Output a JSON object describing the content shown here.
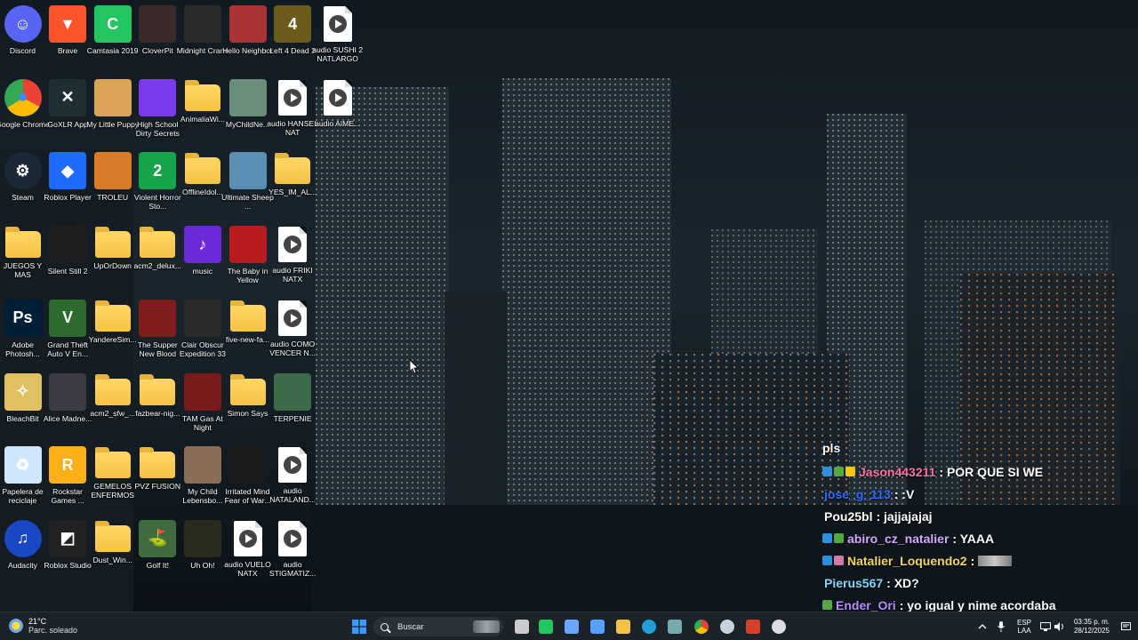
{
  "desktop": {
    "icons": [
      {
        "label": "Discord",
        "icon": "discord-icon",
        "color": "#5865f2"
      },
      {
        "label": "Brave",
        "icon": "brave-icon",
        "color": "#fb542b"
      },
      {
        "label": "Camtasia 2019",
        "icon": "camtasia-icon",
        "color": "#22c55e"
      },
      {
        "label": "CloverPit",
        "icon": "cloverpit-icon",
        "color": "#3a2a2a"
      },
      {
        "label": "Midnight Crane",
        "icon": "midnight-crane-icon",
        "color": "#2b2b2b"
      },
      {
        "label": "Hello Neighbor",
        "icon": "hello-neighbor-icon",
        "color": "#a33"
      },
      {
        "label": "Left 4 Dead 2",
        "icon": "left4dead2-icon",
        "color": "#6b5a1c"
      },
      {
        "label": "audio SUSHI 2 NATLARGO",
        "icon": "audio-file-icon",
        "color": "#ffffff"
      },
      {
        "label": "Google Chrome",
        "icon": "chrome-icon",
        "color": "#4285f4"
      },
      {
        "label": "GoXLR App",
        "icon": "goxlr-icon",
        "color": "#1f2f33"
      },
      {
        "label": "My Little Puppy",
        "icon": "my-little-puppy-icon",
        "color": "#d9a35a"
      },
      {
        "label": "High School Dirty Secrets",
        "icon": "high-school-icon",
        "color": "#7c3aed"
      },
      {
        "label": "AnimaliaWi...",
        "icon": "folder-icon",
        "color": "#f6c244"
      },
      {
        "label": "MyChildNe...",
        "icon": "my-child-icon",
        "color": "#6b8e7a"
      },
      {
        "label": "audio HANSEL NAT",
        "icon": "audio-file-icon",
        "color": "#ffffff"
      },
      {
        "label": "audio AIME...",
        "icon": "audio-file-icon",
        "color": "#ffffff"
      },
      {
        "label": "Steam",
        "icon": "steam-icon",
        "color": "#1b2838"
      },
      {
        "label": "Roblox Player",
        "icon": "roblox-icon",
        "color": "#1e6bff"
      },
      {
        "label": "TROLEU",
        "icon": "troleu-icon",
        "color": "#d97b29"
      },
      {
        "label": "Violent Horror Sto...",
        "icon": "violent-horror-icon",
        "color": "#16a34a"
      },
      {
        "label": "OfflineIdol...",
        "icon": "folder-icon",
        "color": "#f6c244"
      },
      {
        "label": "Ultimate Sheep ...",
        "icon": "ultimate-sheep-icon",
        "color": "#5a8fb3"
      },
      {
        "label": "YES_IM_AL...",
        "icon": "folder-icon",
        "color": "#f6c244"
      },
      {
        "label": "JUEGOS Y MAS",
        "icon": "folder-icon",
        "color": "#f6c244"
      },
      {
        "label": "Silent Still 2",
        "icon": "silent-still-icon",
        "color": "#1f1f1f"
      },
      {
        "label": "UpOrDown",
        "icon": "folder-icon",
        "color": "#f6c244"
      },
      {
        "label": "acm2_delux...",
        "icon": "folder-icon",
        "color": "#f6c244"
      },
      {
        "label": "music",
        "icon": "music-icon",
        "color": "#6d28d9"
      },
      {
        "label": "The Baby in Yellow",
        "icon": "baby-in-yellow-icon",
        "color": "#b91c1c"
      },
      {
        "label": "audio FRIKI NATX",
        "icon": "audio-file-icon",
        "color": "#ffffff"
      },
      {
        "label": "Adobe Photosh...",
        "icon": "photoshop-icon",
        "color": "#001e36"
      },
      {
        "label": "Grand Theft Auto V En...",
        "icon": "gta-icon",
        "color": "#2d6a2d"
      },
      {
        "label": "YandereSim...",
        "icon": "folder-icon",
        "color": "#f6c244"
      },
      {
        "label": "The Supper New Blood",
        "icon": "supper-icon",
        "color": "#7f1d1d"
      },
      {
        "label": "Clair Obscur Expedition 33",
        "icon": "clair-obscur-icon",
        "color": "#2a2a2a"
      },
      {
        "label": "five-new-fa...",
        "icon": "folder-icon",
        "color": "#f6c244"
      },
      {
        "label": "audio COMO VENCER N...",
        "icon": "audio-file-icon",
        "color": "#ffffff"
      },
      {
        "label": "BleachBit",
        "icon": "bleachbit-icon",
        "color": "#e0c060"
      },
      {
        "label": "Alice Madne...",
        "icon": "alice-icon",
        "color": "#3b3b46"
      },
      {
        "label": "acm2_sfw_...",
        "icon": "folder-icon",
        "color": "#f6c244"
      },
      {
        "label": "fazbear-nig...",
        "icon": "folder-icon",
        "color": "#f6c244"
      },
      {
        "label": "TAM Gas At Night",
        "icon": "tam-gas-icon",
        "color": "#7a1b1b"
      },
      {
        "label": "Simon Says",
        "icon": "folder-icon",
        "color": "#f6c244"
      },
      {
        "label": "TERPENIE",
        "icon": "terpenie-icon",
        "color": "#3d6b4a"
      },
      {
        "label": "Papelera de reciclaje",
        "icon": "recycle-bin-icon",
        "color": "#cfe6ff"
      },
      {
        "label": "Rockstar Games ...",
        "icon": "rockstar-icon",
        "color": "#fcaf17"
      },
      {
        "label": "GEMELOS ENFERMOS",
        "icon": "folder-icon",
        "color": "#f6c244"
      },
      {
        "label": "PVZ FUSION",
        "icon": "folder-icon",
        "color": "#f6c244"
      },
      {
        "label": "My Child Lebensbo...",
        "icon": "my-child-lebensborn-icon",
        "color": "#8a6d54"
      },
      {
        "label": "Irritated Mind Fear of War...",
        "icon": "irritated-mind-icon",
        "color": "#1a1a1a"
      },
      {
        "label": "audio NATALAND...",
        "icon": "audio-file-icon",
        "color": "#ffffff"
      },
      {
        "label": "Audacity",
        "icon": "audacity-icon",
        "color": "#1947c5"
      },
      {
        "label": "Roblox Studio",
        "icon": "roblox-studio-icon",
        "color": "#222"
      },
      {
        "label": "Dust_Win...",
        "icon": "folder-icon",
        "color": "#f6c244"
      },
      {
        "label": "Golf It!",
        "icon": "golf-it-icon",
        "color": "#3f6b3f"
      },
      {
        "label": "Uh Oh!",
        "icon": "uh-oh-icon",
        "color": "#2a2a1e"
      },
      {
        "label": "audio VUELO NATX",
        "icon": "audio-file-icon",
        "color": "#ffffff"
      },
      {
        "label": "audio STIGMATIZ...",
        "icon": "audio-file-icon",
        "color": "#ffffff"
      }
    ]
  },
  "chat": {
    "title": "pls",
    "messages": [
      {
        "user": "Jason443211",
        "user_color": "#ff6f9e",
        "text": ": POR QUE SI WE",
        "badges": [
          "#2f8fdc",
          "#55a844",
          "#f5c518"
        ]
      },
      {
        "user": "jose_g_113",
        "user_color": "#2f6bff",
        "text": ": :V",
        "badges": []
      },
      {
        "user": "Pou25bl",
        "user_color": "#ffffff",
        "text": ": jajjajajaj",
        "badges": []
      },
      {
        "user": "abiro_cz_natalier",
        "user_color": "#d6a6ff",
        "text": ": YAAA",
        "badges": [
          "#2f8fdc",
          "#55a844"
        ]
      },
      {
        "user": "Natalier_Loquendo2",
        "user_color": "#f3d75b",
        "text": ":",
        "badges": [
          "#2f8fdc",
          "#d07aa8"
        ],
        "emote": true
      },
      {
        "user": "Pierus567",
        "user_color": "#7ed8ff",
        "text": ": XD?",
        "badges": []
      },
      {
        "user": "Ender_Ori",
        "user_color": "#b88aff",
        "text": ": yo igual y nime acordaba",
        "badges": [
          "#55a844"
        ]
      }
    ]
  },
  "taskbar": {
    "weather": {
      "temp": "21°C",
      "condition": "Parc. soleado",
      "icon": "partly-sunny-icon"
    },
    "search_placeholder": "Buscar",
    "apps": [
      {
        "name": "start",
        "icon": "windows-icon",
        "color": "#3b9cff"
      },
      {
        "name": "task-view",
        "icon": "task-view-icon",
        "color": "#cccccc"
      },
      {
        "name": "camtasia",
        "icon": "camtasia-icon",
        "color": "#22c55e"
      },
      {
        "name": "copilot",
        "icon": "copilot-icon",
        "color": "#6aa6ff"
      },
      {
        "name": "store",
        "icon": "store-icon",
        "color": "#5aa0ff"
      },
      {
        "name": "explorer",
        "icon": "folder-icon",
        "color": "#f6c244"
      },
      {
        "name": "edge",
        "icon": "edge-icon",
        "color": "#1fa0d8"
      },
      {
        "name": "goxlr",
        "icon": "goxlr-icon",
        "color": "#7aa"
      },
      {
        "name": "chrome",
        "icon": "chrome-icon",
        "color": "#4285f4"
      },
      {
        "name": "steam",
        "icon": "steam-icon",
        "color": "#c6d4df"
      },
      {
        "name": "brave",
        "icon": "brave-icon",
        "color": "#d6402a"
      },
      {
        "name": "obs",
        "icon": "obs-icon",
        "color": "#dddddd"
      }
    ],
    "lang": {
      "line1": "ESP",
      "line2": "LAA"
    },
    "clock": {
      "time": "03:35 p. m.",
      "date": "28/12/2025"
    }
  }
}
